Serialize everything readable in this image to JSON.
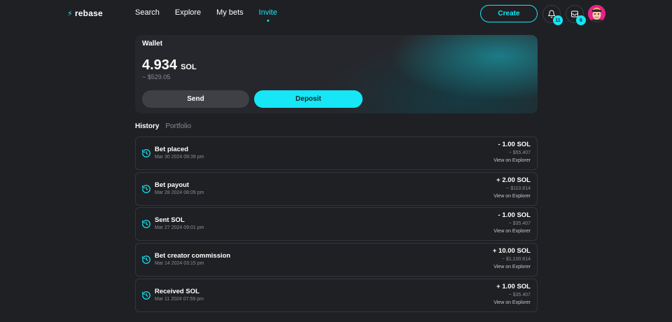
{
  "brand": {
    "name": "rebase"
  },
  "nav": {
    "links": [
      {
        "label": "Search"
      },
      {
        "label": "Explore"
      },
      {
        "label": "My bets"
      },
      {
        "label": "Invite"
      }
    ],
    "active": "Invite",
    "create_label": "Create",
    "notifications_count": "11",
    "messages_count": "6"
  },
  "wallet": {
    "title": "Wallet",
    "amount": "4.934",
    "unit": "SOL",
    "usd": "~ $529.05",
    "send_label": "Send",
    "deposit_label": "Deposit"
  },
  "tabs": [
    {
      "label": "History"
    },
    {
      "label": "Portfolio"
    }
  ],
  "active_tab": "History",
  "history": [
    {
      "title": "Bet placed",
      "date": "Mar 30 2024 09:39 pm",
      "amount": "- 1.00 SOL",
      "usd": "~ $55.407",
      "link": "View on Explorer"
    },
    {
      "title": "Bet payout",
      "date": "Mar 28 2024 08:09 pm",
      "amount": "+ 2.00 SOL",
      "usd": "~ $110.814",
      "link": "View on Explorer"
    },
    {
      "title": "Sent SOL",
      "date": "Mar 27 2024 09:01 pm",
      "amount": "- 1.00 SOL",
      "usd": "~ $35.407",
      "link": "View on Explorer"
    },
    {
      "title": "Bet creator commission",
      "date": "Mar 14 2024 03:15 pm",
      "amount": "+ 10.00 SOL",
      "usd": "~ $1,100.814",
      "link": "View on Explorer"
    },
    {
      "title": "Received SOL",
      "date": "Mar 11 2024 07:59 pm",
      "amount": "+ 1.00 SOL",
      "usd": "~ $35.407",
      "link": "View on Explorer"
    }
  ],
  "icons": {
    "logo": "bolt-icon",
    "notifications": "bell-icon",
    "messages": "inbox-icon",
    "history_item": "clock-arrow-icon"
  },
  "colors": {
    "accent": "#16e6f5",
    "background": "#1f2024",
    "card": "#26272c",
    "muted_text": "#8a8d94"
  }
}
